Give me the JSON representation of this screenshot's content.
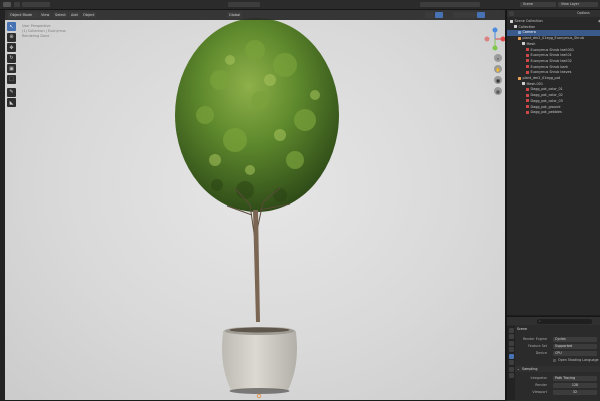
{
  "topbar": {
    "scene_label": "Scene",
    "view_layer_label": "View Layer"
  },
  "viewport": {
    "mode": "Object Mode",
    "menus": [
      "View",
      "Select",
      "Add",
      "Object"
    ],
    "transform_orientation": "Global",
    "overlay_text": [
      "User Perspective",
      "(1) Collection | Euonymus",
      "Rendering Done"
    ]
  },
  "toolbar": {
    "tools": [
      "select-tool",
      "cursor-tool",
      "move-tool",
      "rotate-tool",
      "scale-tool",
      "transform-tool",
      "annotate-tool",
      "measure-tool"
    ]
  },
  "outliner": {
    "header_label": "Options",
    "rows": [
      {
        "label": "Scene Collection",
        "indent": 0,
        "icon": "#cfcfcf"
      },
      {
        "label": "Collection",
        "indent": 1,
        "icon": "#cfcfcf"
      },
      {
        "label": "Camera",
        "indent": 2,
        "icon": "#7fa8d6",
        "selected": true
      },
      {
        "label": "plant_dm2_01egg_Euonymus_Shrub",
        "indent": 2,
        "icon": "#e8a055"
      },
      {
        "label": "Mesh",
        "indent": 3,
        "icon": "#d0d0d0"
      },
      {
        "label": "Euonymus Shrub leaf.001",
        "indent": 4,
        "icon": "#d04848"
      },
      {
        "label": "Euonymus Shrub leaf.01",
        "indent": 4,
        "icon": "#d04848"
      },
      {
        "label": "Euonymus Shrub leaf.02",
        "indent": 4,
        "icon": "#d04848"
      },
      {
        "label": "Euonymus Shrub bark",
        "indent": 4,
        "icon": "#d04848"
      },
      {
        "label": "Euonymus Shrub leaves",
        "indent": 4,
        "icon": "#d04848"
      },
      {
        "label": "plant_dm2_01egg_pot",
        "indent": 2,
        "icon": "#e8a055"
      },
      {
        "label": "Mesh.001",
        "indent": 3,
        "icon": "#d0d0d0"
      },
      {
        "label": "Dagg_pot_color_01",
        "indent": 4,
        "icon": "#d04848"
      },
      {
        "label": "Dagg_pot_color_02",
        "indent": 4,
        "icon": "#d04848"
      },
      {
        "label": "Dagg_pot_color_03",
        "indent": 4,
        "icon": "#d04848"
      },
      {
        "label": "Dagg_pot_ground",
        "indent": 4,
        "icon": "#d04848"
      },
      {
        "label": "Dagg_pot_pebbles",
        "indent": 4,
        "icon": "#d04848"
      }
    ]
  },
  "properties": {
    "title": "Scene",
    "fields": [
      {
        "label": "Render Engine",
        "value": "Cycles"
      },
      {
        "label": "Feature Set",
        "value": "Supported"
      },
      {
        "label": "Device",
        "value": "CPU"
      }
    ],
    "checkbox_label": "Open Shading Language",
    "section_label": "Sampling",
    "integrator": {
      "label": "Integrator",
      "value": "Path Tracing"
    },
    "render_samples": {
      "label": "Render",
      "value": "128"
    },
    "viewport_samples": {
      "label": "Viewport",
      "value": "32"
    }
  },
  "colors": {
    "accent": "#4772b3",
    "axis_x": "#e04b4b",
    "axis_y": "#7fc84c",
    "axis_z": "#4b8be0"
  }
}
